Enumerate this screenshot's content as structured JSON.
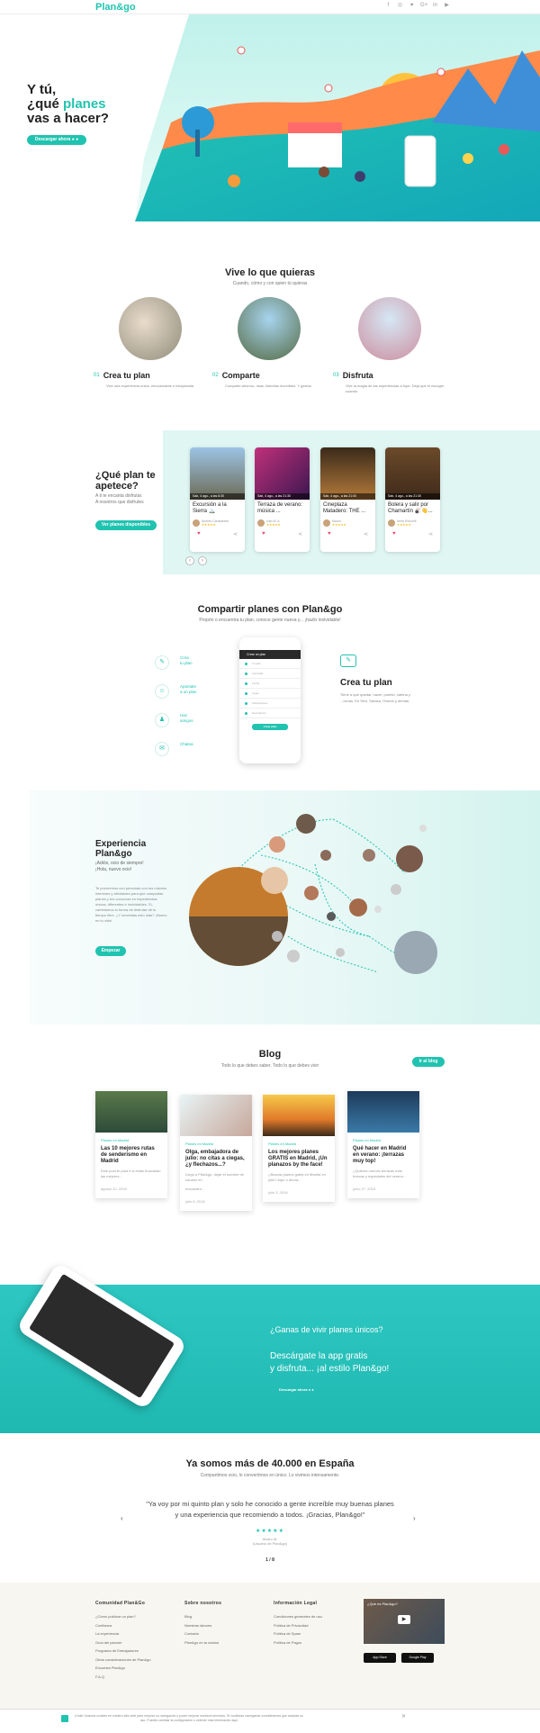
{
  "header": {
    "logo": "Plan&go",
    "social_icons": [
      {
        "name": "facebook-icon",
        "glyph": "f"
      },
      {
        "name": "instagram-icon",
        "glyph": "◎"
      },
      {
        "name": "twitter-icon",
        "glyph": "♥"
      },
      {
        "name": "google-plus-icon",
        "glyph": "G+"
      },
      {
        "name": "linkedin-icon",
        "glyph": "in"
      },
      {
        "name": "youtube-icon",
        "glyph": "▶"
      }
    ]
  },
  "hero": {
    "title_line1": "Y tú,",
    "title_line2_prefix": "¿qué ",
    "title_highlight": "planes",
    "title_line3": "vas a hacer?",
    "download_label": "Descargar ahora"
  },
  "vive": {
    "title": "Vive lo que quieras",
    "subtitle": "Cuando, cómo y con quien tú quieras",
    "features": [
      {
        "num": "01",
        "title": "Crea tu plan",
        "text": "Vive una experiencia única, emocionante e inesperada"
      },
      {
        "num": "02",
        "title": "Comparte",
        "text": "Comparte ahorros, risas, historias increíbles. Y gestos"
      },
      {
        "num": "03",
        "title": "Disfruta",
        "text": "Vive la magia de las experiencias a tope. Deja que el escoger cuando"
      }
    ]
  },
  "plans": {
    "title_line1": "¿Qué plan te",
    "title_line2": "apetece?",
    "text_line1": "A ti te encanta disfrutar.",
    "text_line2": "A nosotros que disfrutes",
    "button": "Ver planes disponibles",
    "cards": [
      {
        "date": "Sab, 4 ago., a las 8:30",
        "name": "Excursión a la Sierra 🏔️",
        "host": "Andrés Carabantes",
        "rating": "★★★★★"
      },
      {
        "date": "Sab, 4 ago., a las 21:30",
        "name": "Terraza de verano: música ...",
        "host": "Iván M. A.",
        "rating": "★★★★★"
      },
      {
        "date": "Sab, 4 ago., a las 21:00",
        "name": "Cineplaza Matadero: THE ...",
        "host": "Mauro",
        "rating": "★★★★★"
      },
      {
        "date": "Sab, 4 ago., a las 21:30",
        "name": "Bolera y salir por Chamartín 🎳👋...",
        "host": "Irene Ronchill",
        "rating": "★★★★★"
      }
    ],
    "prev": "‹",
    "next": "›"
  },
  "share": {
    "title": "Compartir planes con Plan&go",
    "subtitle": "Propón o encuentra tu plan, conoce gente nueva y... ¡hazlo inolvidable!",
    "steps": [
      {
        "icon": "✎",
        "label_line1": "Crea",
        "label_line2": "tu plan"
      },
      {
        "icon": "☺",
        "label_line1": "Apúntate",
        "label_line2": "a un plan"
      },
      {
        "icon": "♟",
        "label_line1": "Haz",
        "label_line2": "amigos"
      },
      {
        "icon": "✉",
        "label_line1": "Chatea",
        "label_line2": ""
      }
    ],
    "phone": {
      "header": "Crear un plan",
      "rows": [
        "Tu plan",
        "Actividad",
        "Fecha",
        "Lugar",
        "Participantes",
        "Descripción"
      ],
      "button": "Crear plan"
    },
    "right_title": "Crea tu plan",
    "right_text": "Tiene a que quedar, hacer, pueblo, cátrina y ...cenas. En Sevi, Sarasú, Oviedo y demás."
  },
  "experiencia": {
    "title_line1": "Experiencia",
    "title_line2": "Plan&go",
    "sub_line1": "¡Adiós, ocio de siempre!",
    "sub_line2": "¡Hola, nuevo ocio!",
    "text": "Te proveemos con personas con tus mismos intereses y afinidades para que compartas planes y tus conozcas en experiencias únicas, diferentes e inolvidables. Sí, cambiamos tu forma de disfrutar de tu tiempo libre. ¿Y necesitas esto más? ¡Nuevo en tu vida!",
    "button": "Empezar"
  },
  "blog": {
    "title": "Blog",
    "subtitle": "Todo lo que debes saber. Todo lo que debes vivir",
    "button": "Ir al blog",
    "posts": [
      {
        "category": "Planes en Madrid",
        "title": "Las 10 mejores rutas de senderismo en Madrid",
        "excerpt": "Este post te para ti si estás buscando las mejores...",
        "date": "agosto 20, 2018"
      },
      {
        "category": "Planes en Madrid",
        "title": "Olga, embajadora de julio: no citas a ciegas, ¿y flechazos...?",
        "excerpt": "Llegó a Plan&go, dejar el nombre de usuario en",
        "excerpt2": "encuentro...",
        "date": "julio 6, 2018"
      },
      {
        "category": "Planes en Madrid",
        "title": "Los mejores planes GRATIS en Madrid, ¡Un planazos by the face!",
        "excerpt": "¿Buscas planes gratis en Madrid en julio? Aquí o ahora...",
        "date": "julio 3, 2018"
      },
      {
        "category": "Planes en Madrid",
        "title": "Qué hacer en Madrid en verano: ¡terrazas muy top!",
        "excerpt": "¿Quieres una las terrazas más frescas y especiales del verano...",
        "date": "junio 27, 2018"
      }
    ]
  },
  "app": {
    "question": "¿Ganas de vivir planes únicos?",
    "line1": "Descárgate la app gratis",
    "line2": "y disfruta... ¡al estilo Plan&go!",
    "download": "Descargar ahora"
  },
  "testimonials": {
    "title": "Ya somos más de 40.000 en España",
    "subtitle": "Compartimos ocio, lo convertimos en único. Lo vivimos intensamente.",
    "quote": "\"Ya voy por mi quinto plan y solo he conocido a gente increíble muy buenas planes y una experiencia que recomiendo a todos. ¡Gracias, Plan&go!\"",
    "stars": "★★★★★",
    "author": "Alvaro M.",
    "author_sub": "(Usuario de Plan&go)",
    "pager": "1 / 8",
    "prev": "‹",
    "next": "›"
  },
  "footer": {
    "col1": {
      "title": "Comunidad Plan&Go",
      "links": [
        "¿Cómo publicar un plan?",
        "Confianza",
        "La experiencia",
        "Guía del planner",
        "Programa de Embajadores",
        "Otras consideraciones de Plan&go",
        "Encuesta Plan&go",
        "F.A.Q"
      ]
    },
    "col2": {
      "title": "Sobre nosotros",
      "links": [
        "Blog",
        "Nuestras labores",
        "Contacto",
        "Plan&go en la ciudad"
      ]
    },
    "col3": {
      "title": "Información Legal",
      "links": [
        "Condiciones generales de uso",
        "Política de Privacidad",
        "Política de Spam",
        "Política de Pagos"
      ]
    },
    "video_title": "¿Qué es Plan&go?",
    "appstore": "App Store",
    "googleplay": "Google Play"
  },
  "cookie": {
    "text": "¡Hola! Usamos cookies en nuestro sitio web para mejorar su navegación y poder mejorar nuestros servicios. Si continúas navegando consideramos que aceptas su uso. Puedes cambiar la configuración u obtener más información aquí",
    "close": "✕"
  }
}
